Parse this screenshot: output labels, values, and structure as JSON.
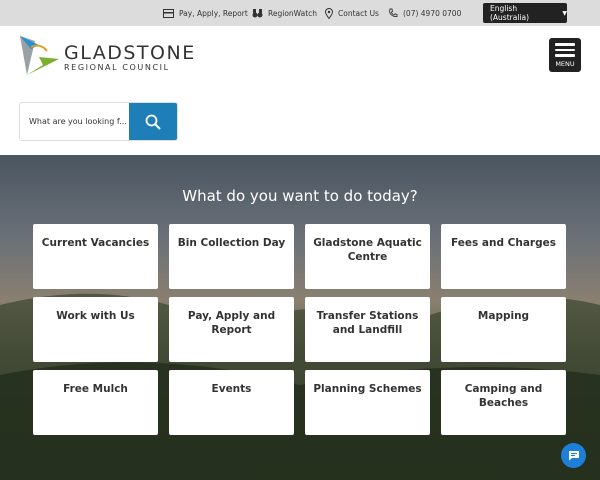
{
  "topbar": {
    "links": [
      {
        "label": "Pay, Apply, Report",
        "icon": "card-icon"
      },
      {
        "label": "RegionWatch",
        "icon": "binoculars-icon"
      },
      {
        "label": "Contact Us",
        "icon": "location-pin-icon"
      },
      {
        "label": "(07) 4970 0700",
        "icon": "phone-icon"
      }
    ],
    "language": "English (Australia)"
  },
  "logo": {
    "line1": "GLADSTONE",
    "line2": "REGIONAL COUNCIL"
  },
  "menu_label": "MENU",
  "search": {
    "placeholder": "What are you looking f..."
  },
  "hero": {
    "title": "What do you want to do today?",
    "tiles": [
      "Current Vacancies",
      "Bin Collection Day",
      "Gladstone Aquatic Centre",
      "Fees and Charges",
      "Work with Us",
      "Pay, Apply and Report",
      "Transfer Stations and Landfill",
      "Mapping",
      "Free Mulch",
      "Events",
      "Planning Schemes",
      "Camping and Beaches"
    ]
  },
  "colors": {
    "accent": "#1e7fb8",
    "dark": "#222222"
  }
}
